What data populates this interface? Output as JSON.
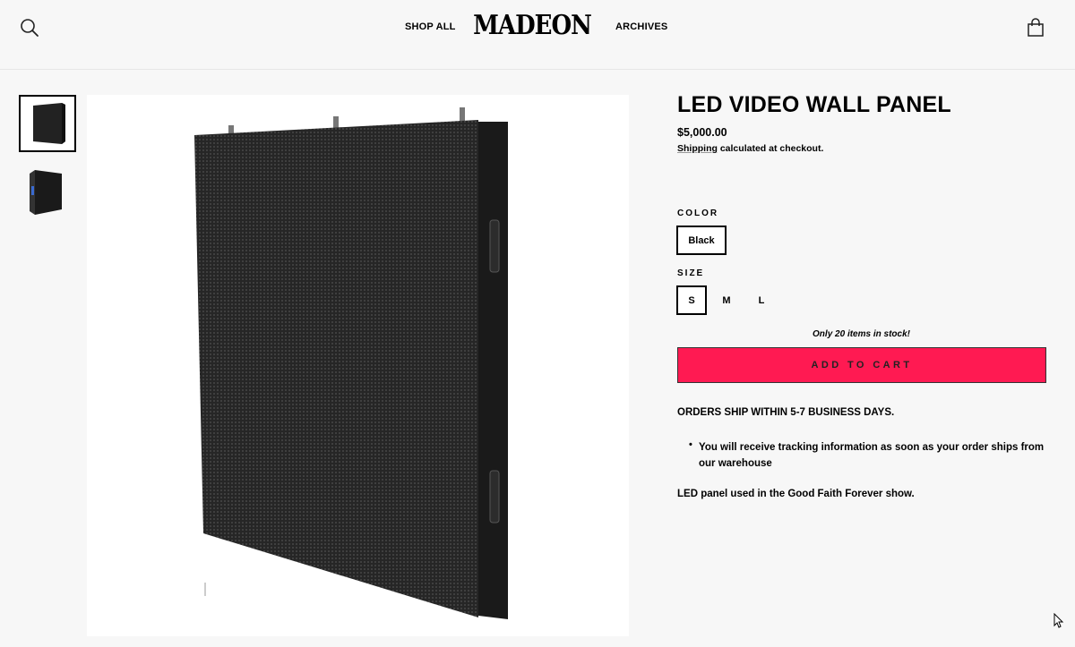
{
  "header": {
    "nav_left": "SHOP ALL",
    "logo_text": "MADEON",
    "nav_right": "ARCHIVES",
    "search_icon": "search-icon",
    "cart_icon": "shopping-bag-icon"
  },
  "gallery": {
    "thumbnails": [
      "led-panel-front",
      "led-panel-back"
    ],
    "selected_index": 0
  },
  "product": {
    "title": "LED VIDEO WALL PANEL",
    "price": "$5,000.00",
    "shipping_link": "Shipping",
    "shipping_rest": " calculated at checkout.",
    "color_label": "COLOR",
    "color_options": [
      "Black"
    ],
    "color_selected": "Black",
    "size_label": "SIZE",
    "size_options": [
      "S",
      "M",
      "L"
    ],
    "size_selected": "S",
    "stock_text": "Only 20 items in stock!",
    "add_to_cart": "ADD TO CART",
    "accent_color": "#ff1a52"
  },
  "description": {
    "heading": "ORDERS SHIP WITHIN 5-7 BUSINESS DAYS.",
    "bullet": "You will receive tracking information as soon as your order ships from our warehouse",
    "body": "LED panel used in the Good Faith Forever show."
  }
}
